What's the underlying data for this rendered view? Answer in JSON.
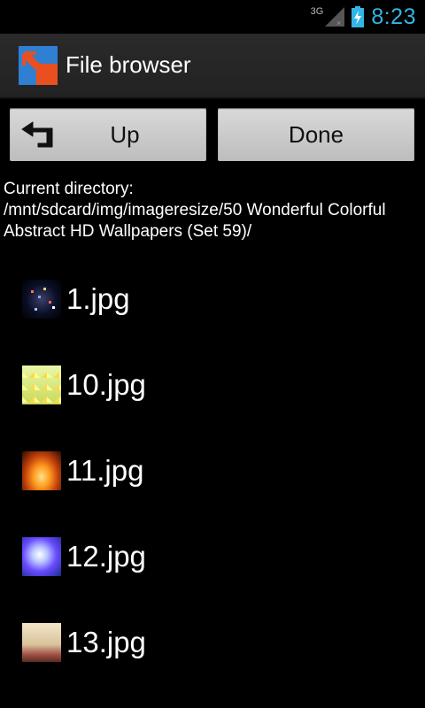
{
  "status_bar": {
    "network": "3G",
    "time": "8:23",
    "accent_color": "#33b5e5"
  },
  "action_bar": {
    "title": "File browser",
    "icon": "file-browser-app-icon"
  },
  "buttons": {
    "up_label": "Up",
    "up_icon": "back-arrow-icon",
    "done_label": "Done"
  },
  "directory": {
    "label": "Current directory:",
    "path": "/mnt/sdcard/img/imageresize/50 Wonderful Colorful Abstract HD Wallpapers (Set 59)/"
  },
  "files": [
    {
      "name": "1.jpg"
    },
    {
      "name": "10.jpg"
    },
    {
      "name": "11.jpg"
    },
    {
      "name": "12.jpg"
    },
    {
      "name": "13.jpg"
    }
  ]
}
